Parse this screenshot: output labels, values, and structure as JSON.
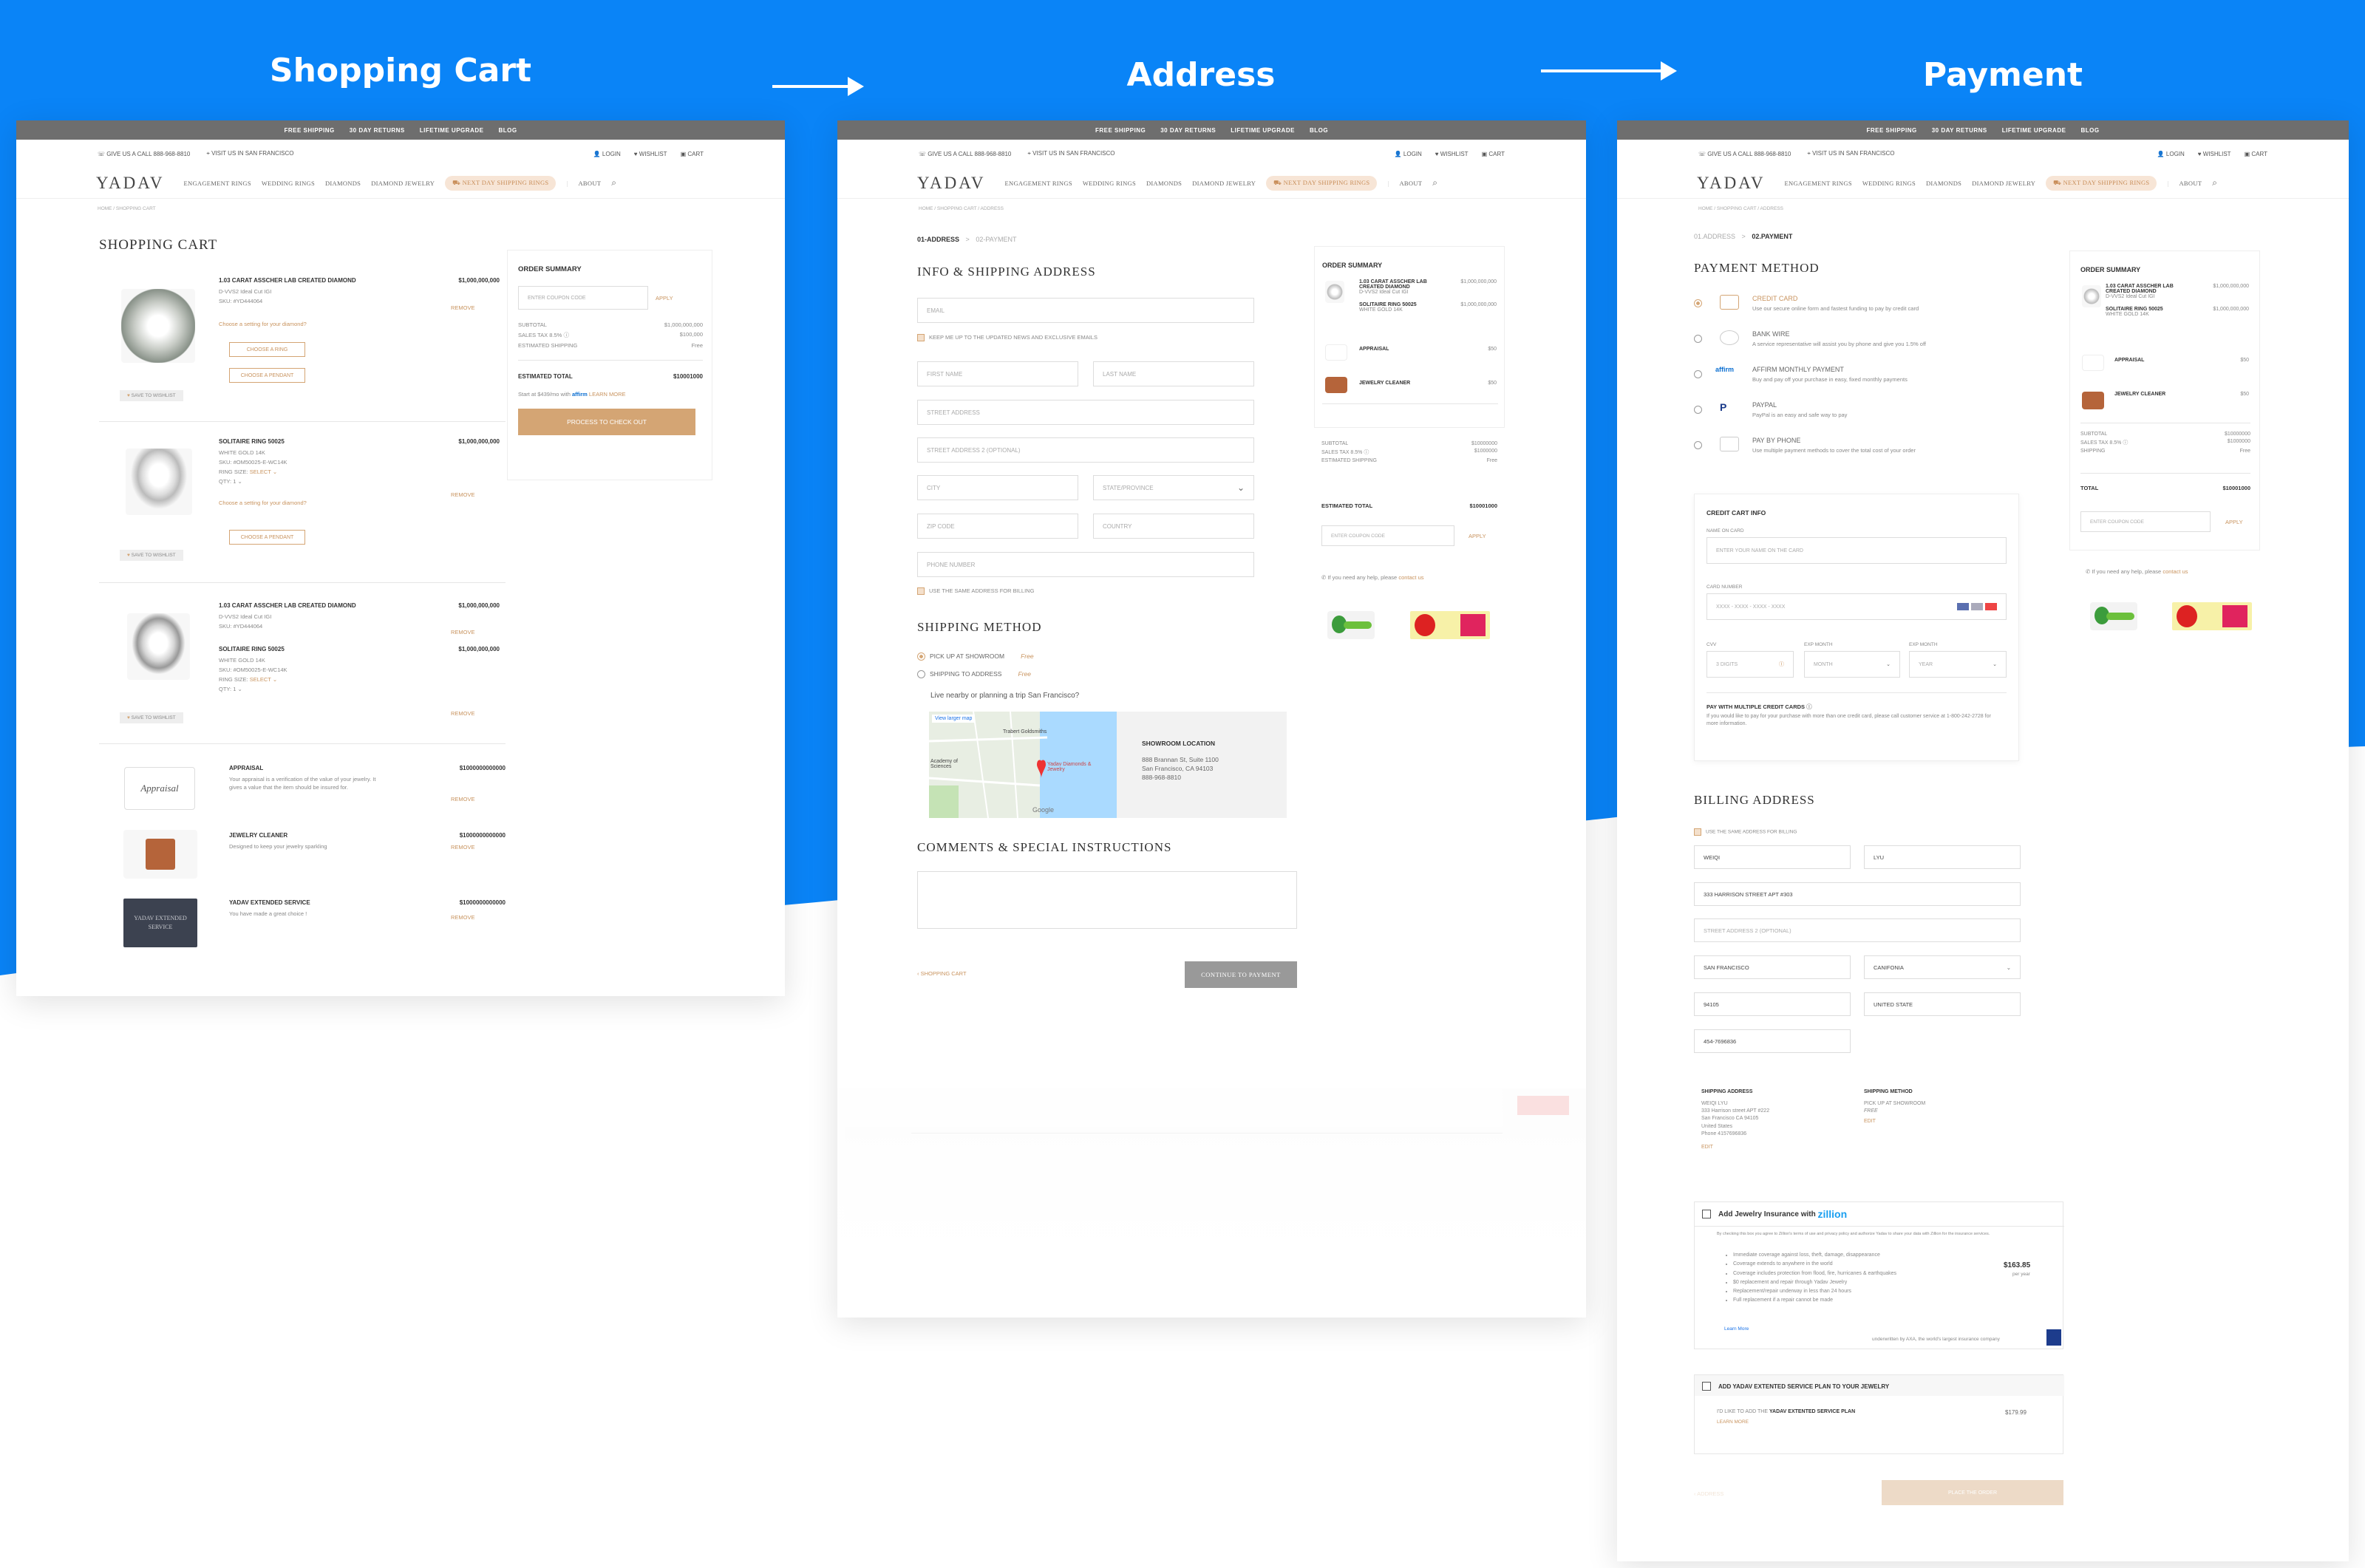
{
  "steps": [
    {
      "title": "Shopping Cart"
    },
    {
      "title": "Address"
    },
    {
      "title": "Payment"
    }
  ],
  "colors": {
    "brand_blue": "#0a84f7",
    "accent_gold": "#d4a574",
    "topbar": "#6e6e6e"
  },
  "site": {
    "topbar": [
      "FREE SHIPPING",
      "30 DAY RETURNS",
      "LIFETIME UPGRADE",
      "BLOG"
    ],
    "call": "GIVE US A CALL 888-968-8810",
    "visit": "VISIT US IN SAN FRANCISCO",
    "login": "LOGIN",
    "wishlist": "WISHLIST",
    "cart": "CART",
    "logo": "YADAV",
    "nav": [
      "ENGAGEMENT RINGS",
      "WEDDING RINGS",
      "DIAMONDS",
      "DIAMOND JEWELRY"
    ],
    "promo": "NEXT DAY SHIPPING RINGS",
    "about": "ABOUT",
    "search_icon": "search-icon"
  },
  "cart": {
    "breadcrumb": "HOME / SHOPPING CART",
    "title": "SHOPPING CART",
    "items": [
      {
        "name": "1.03 CARAT ASSCHER LAB CREATED DIAMOND",
        "price": "$1,000,000,000",
        "line1": "D-VVS2 Ideal Cut IGI",
        "line2": "SKU: #YD444064",
        "prompt": "Choose a setting for your diamond?",
        "btn1": "CHOOSE A RING",
        "btn2": "CHOOSE A PENDANT",
        "remove": "REMOVE",
        "save": "SAVE TO WISHLIST"
      },
      {
        "name": "SOLITAIRE RING 50025",
        "price": "$1,000,000,000",
        "line1": "WHITE GOLD 14K",
        "line2": "SKU: #OM50025-E-WC14K",
        "ring_size": "RING SIZE:",
        "select": "SELECT",
        "qty": "QTY:",
        "qty_val": "1",
        "prompt": "Choose a setting for your diamond?",
        "btn1": "CHOOSE A PENDANT",
        "remove": "REMOVE",
        "save": "SAVE TO WISHLIST"
      },
      {
        "name": "1.03 CARAT ASSCHER LAB CREATED DIAMOND",
        "price": "$1,000,000,000",
        "line1": "D-VVS2 Ideal Cut IGI",
        "line2": "SKU: #YD444064",
        "remove": "REMOVE"
      },
      {
        "name": "SOLITAIRE RING 50025",
        "price": "$1,000,000,000",
        "line1": "WHITE GOLD 14K",
        "line2": "SKU: #OM50025-E-WC14K",
        "ring_size": "RING SIZE:",
        "select": "SELECT",
        "qty": "QTY:",
        "qty_val": "1",
        "remove": "REMOVE",
        "save": "SAVE TO WISHLIST"
      }
    ],
    "extras": [
      {
        "name": "APPRAISAL",
        "price": "$1000000000000",
        "desc": "Your appraisal is a verification of the value of your jewelry. It gives a value that the item should be insured for.",
        "remove": "REMOVE",
        "thumb": "Appraisal"
      },
      {
        "name": "JEWELRY CLEANER",
        "price": "$1000000000000",
        "desc": "Designed to keep your jewelry sparkling",
        "remove": "REMOVE"
      },
      {
        "name": "YADAV EXTENDED SERVICE",
        "price": "$1000000000000",
        "desc": "You have made a great choice !",
        "remove": "REMOVE",
        "thumb": "YADAV EXTENDED SERVICE"
      }
    ],
    "summary": {
      "title": "ORDER SUMMARY",
      "coupon_placeholder": "ENTER COUPON CODE",
      "apply": "APPLY",
      "subtotal_label": "SUBTOTAL",
      "subtotal": "$1,000,000,000",
      "tax_label": "SALES TAX 8.5%",
      "tax": "$100,000",
      "ship_label": "ESTIMATED SHIPPING",
      "ship": "Free",
      "total_label": "ESTIMATED TOTAL",
      "total": "$10001000",
      "affirm": "Start at $439/mo with",
      "affirm_brand": "affirm",
      "learn": "LEARN MORE",
      "checkout": "PROCESS TO CHECK OUT"
    }
  },
  "address": {
    "breadcrumb": "HOME / SHOPPING CART / ADDRESS",
    "step1": "01-ADDRESS",
    "sep": ">",
    "step2": "02-PAYMENT",
    "title": "INFO & SHIPPING ADDRESS",
    "email": "EMAIL",
    "news": "KEEP ME UP TO THE UPDATED NEWS AND EXCLUSIVE EMAILS",
    "first": "FIRST NAME",
    "last": "LAST NAME",
    "street": "STREET ADDRESS",
    "street2": "STREET ADDRESS 2 (OPTIONAL)",
    "city": "CITY",
    "state": "STATE/PROVINCE",
    "zip": "ZIP CODE",
    "country": "COUNTRY",
    "phone": "PHONE NUMBER",
    "same": "USE THE SAME ADDRESS FOR BILLING",
    "ship_title": "SHIPPING METHOD",
    "pickup": "PICK UP AT SHOWROOM",
    "pickup_price": "Free",
    "ship_addr": "SHIPPING TO ADDRESS",
    "ship_price": "Free",
    "nearby": "Live nearby or planning a trip San Francisco?",
    "map_link": "View larger map",
    "map_labels": [
      "Trabert Goldsmiths",
      "Yadav Diamonds & Jewelry",
      "Academy of Sciences",
      "Google"
    ],
    "showroom_title": "SHOWROOM LOCATION",
    "showroom_addr1": "888 Brannan St, Suite 1100",
    "showroom_addr2": "San Francisco, CA 94103",
    "showroom_phone": "888-968-8810",
    "comments_title": "COMMENTS & SPECIAL INSTRUCTIONS",
    "back": "SHOPPING CART",
    "continue": "CONTINUE TO PAYMENT",
    "summary": {
      "title": "ORDER SUMMARY",
      "item1": "1.03 CARAT ASSCHER LAB CREATED DIAMOND",
      "item1_sub": "D-VVS2 Ideal Cut IGI",
      "item1_price": "$1,000,000,000",
      "item2": "SOLITAIRE RING 50025",
      "item2_sub": "WHITE GOLD 14K",
      "item2_price": "$1,000,000,000",
      "appraisal": "APPRAISAL",
      "appraisal_price": "$50",
      "cleaner": "JEWELRY CLEANER",
      "cleaner_price": "$50",
      "subtotal_label": "SUBTOTAL",
      "subtotal": "$10000000",
      "tax_label": "SALES TAX 8.5%",
      "tax": "$1000000",
      "ship_label": "ESTIMATED SHIPPING",
      "ship": "Free",
      "total_label": "ESTIMATED TOTAL",
      "total": "$10001000",
      "coupon_placeholder": "ENTER COUPON CODE",
      "apply": "APPLY",
      "help": "If you need any help, please",
      "contact": "contact us"
    }
  },
  "payment": {
    "breadcrumb": "HOME / SHOPPING CART / ADDRESS",
    "step1": "01.ADDRESS",
    "sep": ">",
    "step2": "02.PAYMENT",
    "title": "PAYMENT METHOD",
    "methods": [
      {
        "name": "CREDIT CARD",
        "desc": "Use our secure online form and fastest funding to pay by credit card"
      },
      {
        "name": "BANK WIRE",
        "desc": "A service representative will assist you by phone and give you 1.5% off"
      },
      {
        "name": "AFFIRM MONTHLY PAYMENT",
        "desc": "Buy and pay off your purchase in easy, fixed monthly payments"
      },
      {
        "name": "PAYPAL",
        "desc": "PayPal is an easy and safe way to pay"
      },
      {
        "name": "PAY BY PHONE",
        "desc": "Use multiple payment methods to cover the total cost of your order"
      }
    ],
    "cc_title": "CREDIT CART INFO",
    "name_label": "NAME ON CARD",
    "name_ph": "ENTER YOUR NAME ON THE CARD",
    "num_label": "CARD NUMBER",
    "num_ph": "XXXX - XXXX - XXXX - XXXX",
    "cvv_label": "CVV",
    "cvv_ph": "3 DIGITS",
    "month_label": "EXP MONTH",
    "month_ph": "MONTH",
    "year_label": "EXP MONTH",
    "year_ph": "YEAR",
    "multi_title": "PAY WITH MULTIPLE CREDIT CARDS",
    "multi_desc": "If you would like to pay for your purchase with more than one credit card, please call customer service at 1-800-242-2728 for more information.",
    "billing_title": "BILLING ADDRESS",
    "billing_same": "USE THE SAME ADDRESS FOR BILLING",
    "first": "WEIQI",
    "last": "LYU",
    "street": "333 HARRISON STREET APT #303",
    "street2": "STREET ADDRESS 2 (OPTIONAL)",
    "city": "SAN FRANCISCO",
    "state": "CANIFONIA",
    "zip": "94105",
    "country": "UNITED STATE",
    "phone": "454-7696836",
    "ship_addr_title": "SHIPPING ADDRESS",
    "ship_addr_lines": [
      "WEIQI LYU",
      "333 Harrison street APT #222",
      "San Francisco CA 94105",
      "United States",
      "Phone 4157696836"
    ],
    "edit": "EDIT",
    "ship_method_title": "SHIPPING METHOD",
    "ship_method": "PICK UP AT SHOWROOM",
    "ship_method_price": "FREE",
    "ins_title": "Add Jewelry Insurance with",
    "ins_brand": "zillion",
    "ins_fine": "By checking this box you agree to Zillion's terms of use and privacy policy and authorize Yadav to share your data with Zillion for the insurance services.",
    "ins_points": [
      "Immediate coverage against loss, theft, damage, disappearance",
      "Coverage extends to anywhere in the world",
      "Coverage includes protection from flood, fire, hurricanes & earthquakes",
      "$0 replacement and repair through Yadav Jewelry",
      "Replacement/repair underway in less than 24 hours",
      "Full replacement if a repair cannot be made"
    ],
    "ins_learn": "Learn More",
    "ins_price": "$163.85",
    "ins_per": "per year",
    "ins_under": "underwritten by AXA, the world's largest insurance company",
    "ext_title": "ADD YADAV EXTENTED SERVICE PLAN TO YOUR JEWELRY",
    "ext_line_pre": "I'D LIKE TO ADD THE",
    "ext_line_bold": "YADAV EXTENTED SERVICE PLAN",
    "ext_price": "$179.99",
    "ext_learn": "LEARN MORE",
    "back": "ADDRESS",
    "place": "PLACE THE ORDER",
    "summary": {
      "title": "ORDER SUMMARY",
      "item1": "1.03 CARAT ASSCHER LAB CREATED DIAMOND",
      "item1_sub": "D-VVS2 Ideal Cut IGI",
      "item1_price": "$1,000,000,000",
      "item2": "SOLITAIRE RING 50025",
      "item2_sub": "WHITE GOLD 14K",
      "item2_price": "$1,000,000,000",
      "appraisal": "APPRAISAL",
      "appraisal_price": "$50",
      "cleaner": "JEWELRY CLEANER",
      "cleaner_price": "$50",
      "subtotal_label": "SUBTOTAL",
      "subtotal": "$10000000",
      "tax_label": "SALES TAX 8.5%",
      "tax": "$1000000",
      "ship_label": "SHIPPING",
      "ship": "Free",
      "total_label": "TOTAL",
      "total": "$10001000",
      "coupon_placeholder": "ENTER COUPON CODE",
      "apply": "APPLY",
      "help": "If you need any help, please",
      "contact": "contact us"
    }
  }
}
